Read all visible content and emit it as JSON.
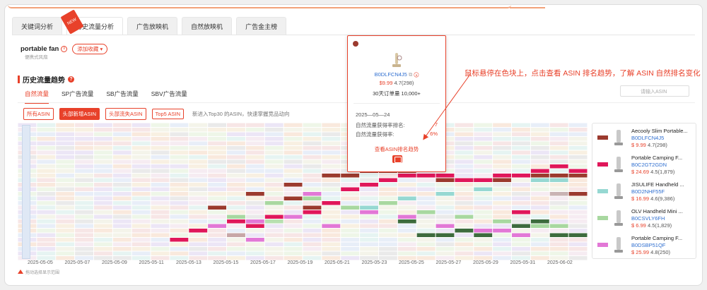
{
  "main_tabs": [
    {
      "label": "关键词分析"
    },
    {
      "label": "历史流量分析",
      "badge": "NEW"
    },
    {
      "label": "广告放映机"
    },
    {
      "label": "自然放映机"
    },
    {
      "label": "广告金主榜"
    }
  ],
  "keyword": {
    "text": "portable fan",
    "fav_label": "添加收藏",
    "subtitle": "便携式风扇"
  },
  "section": {
    "title": "历史流量趋势"
  },
  "sub_tabs": [
    {
      "label": "自然流量"
    },
    {
      "label": "SP广告流量"
    },
    {
      "label": "SB广告流量"
    },
    {
      "label": "SBV广告流量"
    }
  ],
  "search": {
    "placeholder": "请输入ASIN"
  },
  "filter_chips": [
    {
      "label": "所有ASIN"
    },
    {
      "label": "头部新增ASIN",
      "active": true
    },
    {
      "label": "头部流失ASIN"
    },
    {
      "label": "Top5 ASIN"
    }
  ],
  "filter_note": "新进入Top30 的ASIN，快速掌握竞品动向",
  "x_axis_dates": [
    "2025-05-05",
    "2025-05-07",
    "2025-05-09",
    "2025-05-11",
    "2025-05-13",
    "2025-05-15",
    "2025-05-17",
    "2025-05-19",
    "2025-05-21",
    "2025-05-23",
    "2025-05-25",
    "2025-05-27",
    "2025-05-29",
    "2025-05-31",
    "2025-06-02"
  ],
  "bottom_note": "拖动选择显示范围",
  "tooltip": {
    "asin": "B0DLFCN4J5",
    "price": "$9.99",
    "rating": "4.7(298)",
    "sales_label": "30天订单量",
    "sales_value": "10,000+",
    "date": "2025—05—24",
    "row1_label": "自然流量获得率排名:",
    "row1_value": "7",
    "row2_label": "自然流量获得率:",
    "row2_value": "6%",
    "link": "查看ASIN排名趋势"
  },
  "annotation": "鼠标悬停在色块上，点击查看 ASIN 排名趋势，了解 ASIN 自然排名变化",
  "legend_items": [
    {
      "title": "Aecooly Slim Portable...",
      "asin": "B0DLFCN4J5",
      "price": "$ 9.99",
      "rating": "4.7(298)",
      "color": "#9b3a2e"
    },
    {
      "title": "Portable Camping F...",
      "asin": "B0C2GT2GDN",
      "price": "$ 24.69",
      "rating": "4.5(1,879)",
      "color": "#e0175a"
    },
    {
      "title": "JISULIFE Handheld ...",
      "asin": "B0D2NHF55F",
      "price": "$ 16.99",
      "rating": "4.6(9,386)",
      "color": "#96d8d2"
    },
    {
      "title": "OLV Handheld Mini ...",
      "asin": "B0CSVLY6FH",
      "price": "$ 6.99",
      "rating": "4.5(1,829)",
      "color": "#a8d8a0"
    },
    {
      "title": "Portable Camping F...",
      "asin": "B0DSBP51QF",
      "price": "$ 25.99",
      "rating": "4.8(250)",
      "color": "#e278d6"
    }
  ],
  "colors": {
    "accent": "#e8412a",
    "link": "#2f6fd0"
  }
}
